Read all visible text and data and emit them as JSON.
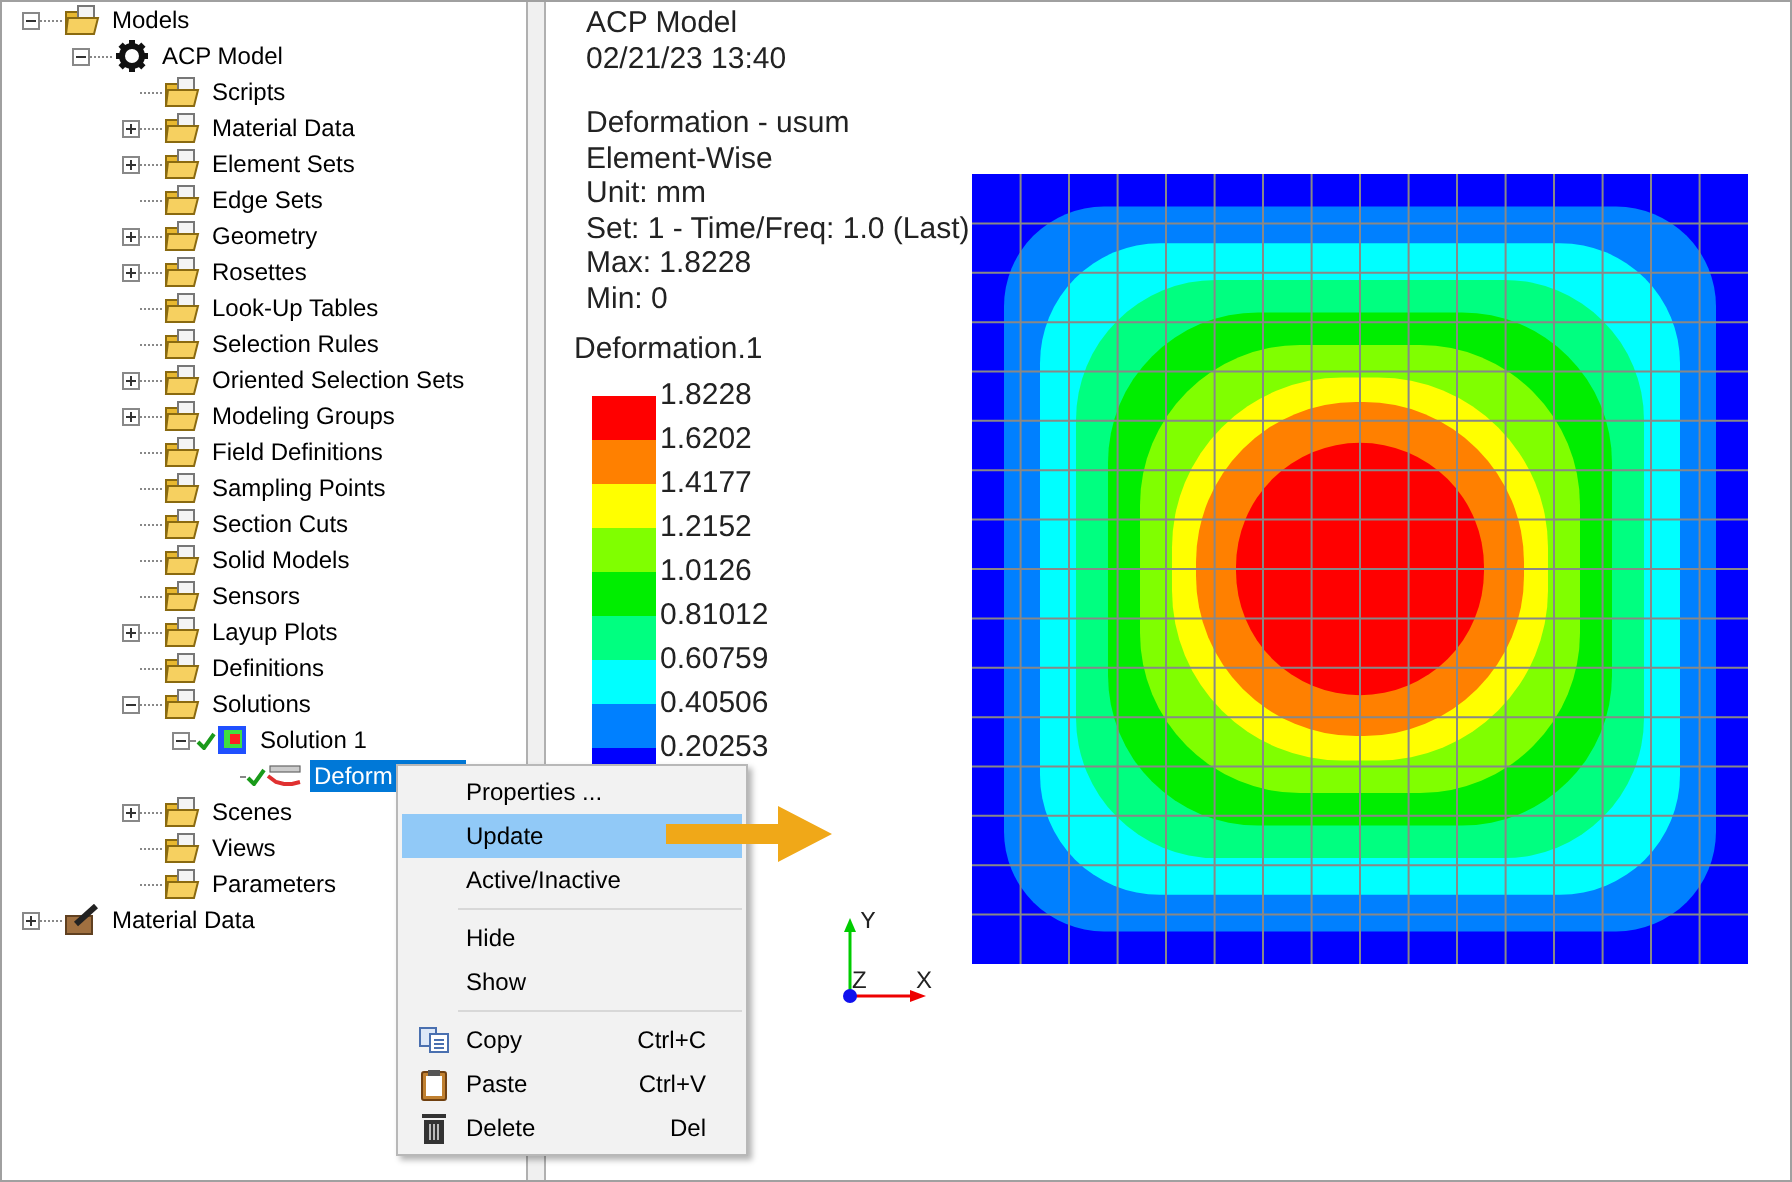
{
  "tree": [
    {
      "label": "Models",
      "kind": "folder",
      "expanded": true,
      "selected": false,
      "children": [
        {
          "label": "ACP Model",
          "kind": "gear",
          "expanded": true,
          "selected": false,
          "children": [
            {
              "label": "Scripts",
              "kind": "folder",
              "selected": false
            },
            {
              "label": "Material Data",
              "kind": "folder",
              "expanded": false,
              "selected": false
            },
            {
              "label": "Element Sets",
              "kind": "folder",
              "expanded": false,
              "selected": false
            },
            {
              "label": "Edge Sets",
              "kind": "folder",
              "selected": false
            },
            {
              "label": "Geometry",
              "kind": "folder",
              "expanded": false,
              "selected": false
            },
            {
              "label": "Rosettes",
              "kind": "folder",
              "expanded": false,
              "selected": false
            },
            {
              "label": "Look-Up Tables",
              "kind": "folder",
              "selected": false
            },
            {
              "label": "Selection Rules",
              "kind": "folder",
              "selected": false
            },
            {
              "label": "Oriented Selection Sets",
              "kind": "folder",
              "expanded": false,
              "selected": false
            },
            {
              "label": "Modeling Groups",
              "kind": "folder",
              "expanded": false,
              "selected": false
            },
            {
              "label": "Field Definitions",
              "kind": "folder",
              "selected": false
            },
            {
              "label": "Sampling Points",
              "kind": "folder",
              "selected": false
            },
            {
              "label": "Section Cuts",
              "kind": "folder",
              "selected": false
            },
            {
              "label": "Solid Models",
              "kind": "folder",
              "selected": false
            },
            {
              "label": "Sensors",
              "kind": "folder",
              "selected": false
            },
            {
              "label": "Layup Plots",
              "kind": "folder",
              "expanded": false,
              "selected": false
            },
            {
              "label": "Definitions",
              "kind": "folder",
              "selected": false
            },
            {
              "label": "Solutions",
              "kind": "folder",
              "expanded": true,
              "selected": false,
              "children": [
                {
                  "label": "Solution 1",
                  "kind": "solution",
                  "valid": true,
                  "expanded": true,
                  "selected": false,
                  "children": [
                    {
                      "label": "Deform",
                      "kind": "result",
                      "valid": true,
                      "selected": true
                    }
                  ]
                }
              ]
            },
            {
              "label": "Scenes",
              "kind": "folder",
              "expanded": false,
              "selected": false
            },
            {
              "label": "Views",
              "kind": "folder",
              "selected": false
            },
            {
              "label": "Parameters",
              "kind": "folder",
              "selected": false
            }
          ]
        }
      ]
    },
    {
      "label": "Material Data",
      "kind": "material",
      "expanded": false,
      "selected": false
    }
  ],
  "viewport": {
    "info": [
      "ACP Model",
      "02/21/23 13:40"
    ],
    "result_info": [
      "Deformation - usum",
      "Element-Wise",
      "Unit: mm",
      "Set: 1 - Time/Freq: 1.0 (Last)",
      "Max: 1.8228",
      "Min: 0"
    ],
    "legend": {
      "title": "Deformation.1",
      "entries": [
        {
          "label": "1.8228",
          "color": "#ff0000"
        },
        {
          "label": "1.6202",
          "color": "#ff8000"
        },
        {
          "label": "1.4177",
          "color": "#ffff00"
        },
        {
          "label": "1.2152",
          "color": "#80ff00"
        },
        {
          "label": "1.0126",
          "color": "#00ee00"
        },
        {
          "label": "0.81012",
          "color": "#00ff80"
        },
        {
          "label": "0.60759",
          "color": "#00ffff"
        },
        {
          "label": "0.40506",
          "color": "#0080ff"
        },
        {
          "label": "0.20253",
          "color": "#0000ff"
        }
      ]
    },
    "axes": {
      "x": "X",
      "y": "Y",
      "z": "Z"
    }
  },
  "context_menu": [
    {
      "kind": "plain",
      "label": "Properties ...",
      "selected": false
    },
    {
      "kind": "plain",
      "label": "Update",
      "selected": true
    },
    {
      "kind": "plain",
      "label": "Active/Inactive",
      "selected": false
    },
    {
      "kind": "separator"
    },
    {
      "kind": "plain",
      "label": "Hide",
      "selected": false
    },
    {
      "kind": "plain",
      "label": "Show",
      "selected": false
    },
    {
      "kind": "separator"
    },
    {
      "kind": "copy",
      "label": "Copy",
      "shortcut": "Ctrl+C",
      "selected": false
    },
    {
      "kind": "paste",
      "label": "Paste",
      "shortcut": "Ctrl+V",
      "selected": false
    },
    {
      "kind": "delete",
      "label": "Delete",
      "shortcut": "Del",
      "selected": false
    }
  ]
}
